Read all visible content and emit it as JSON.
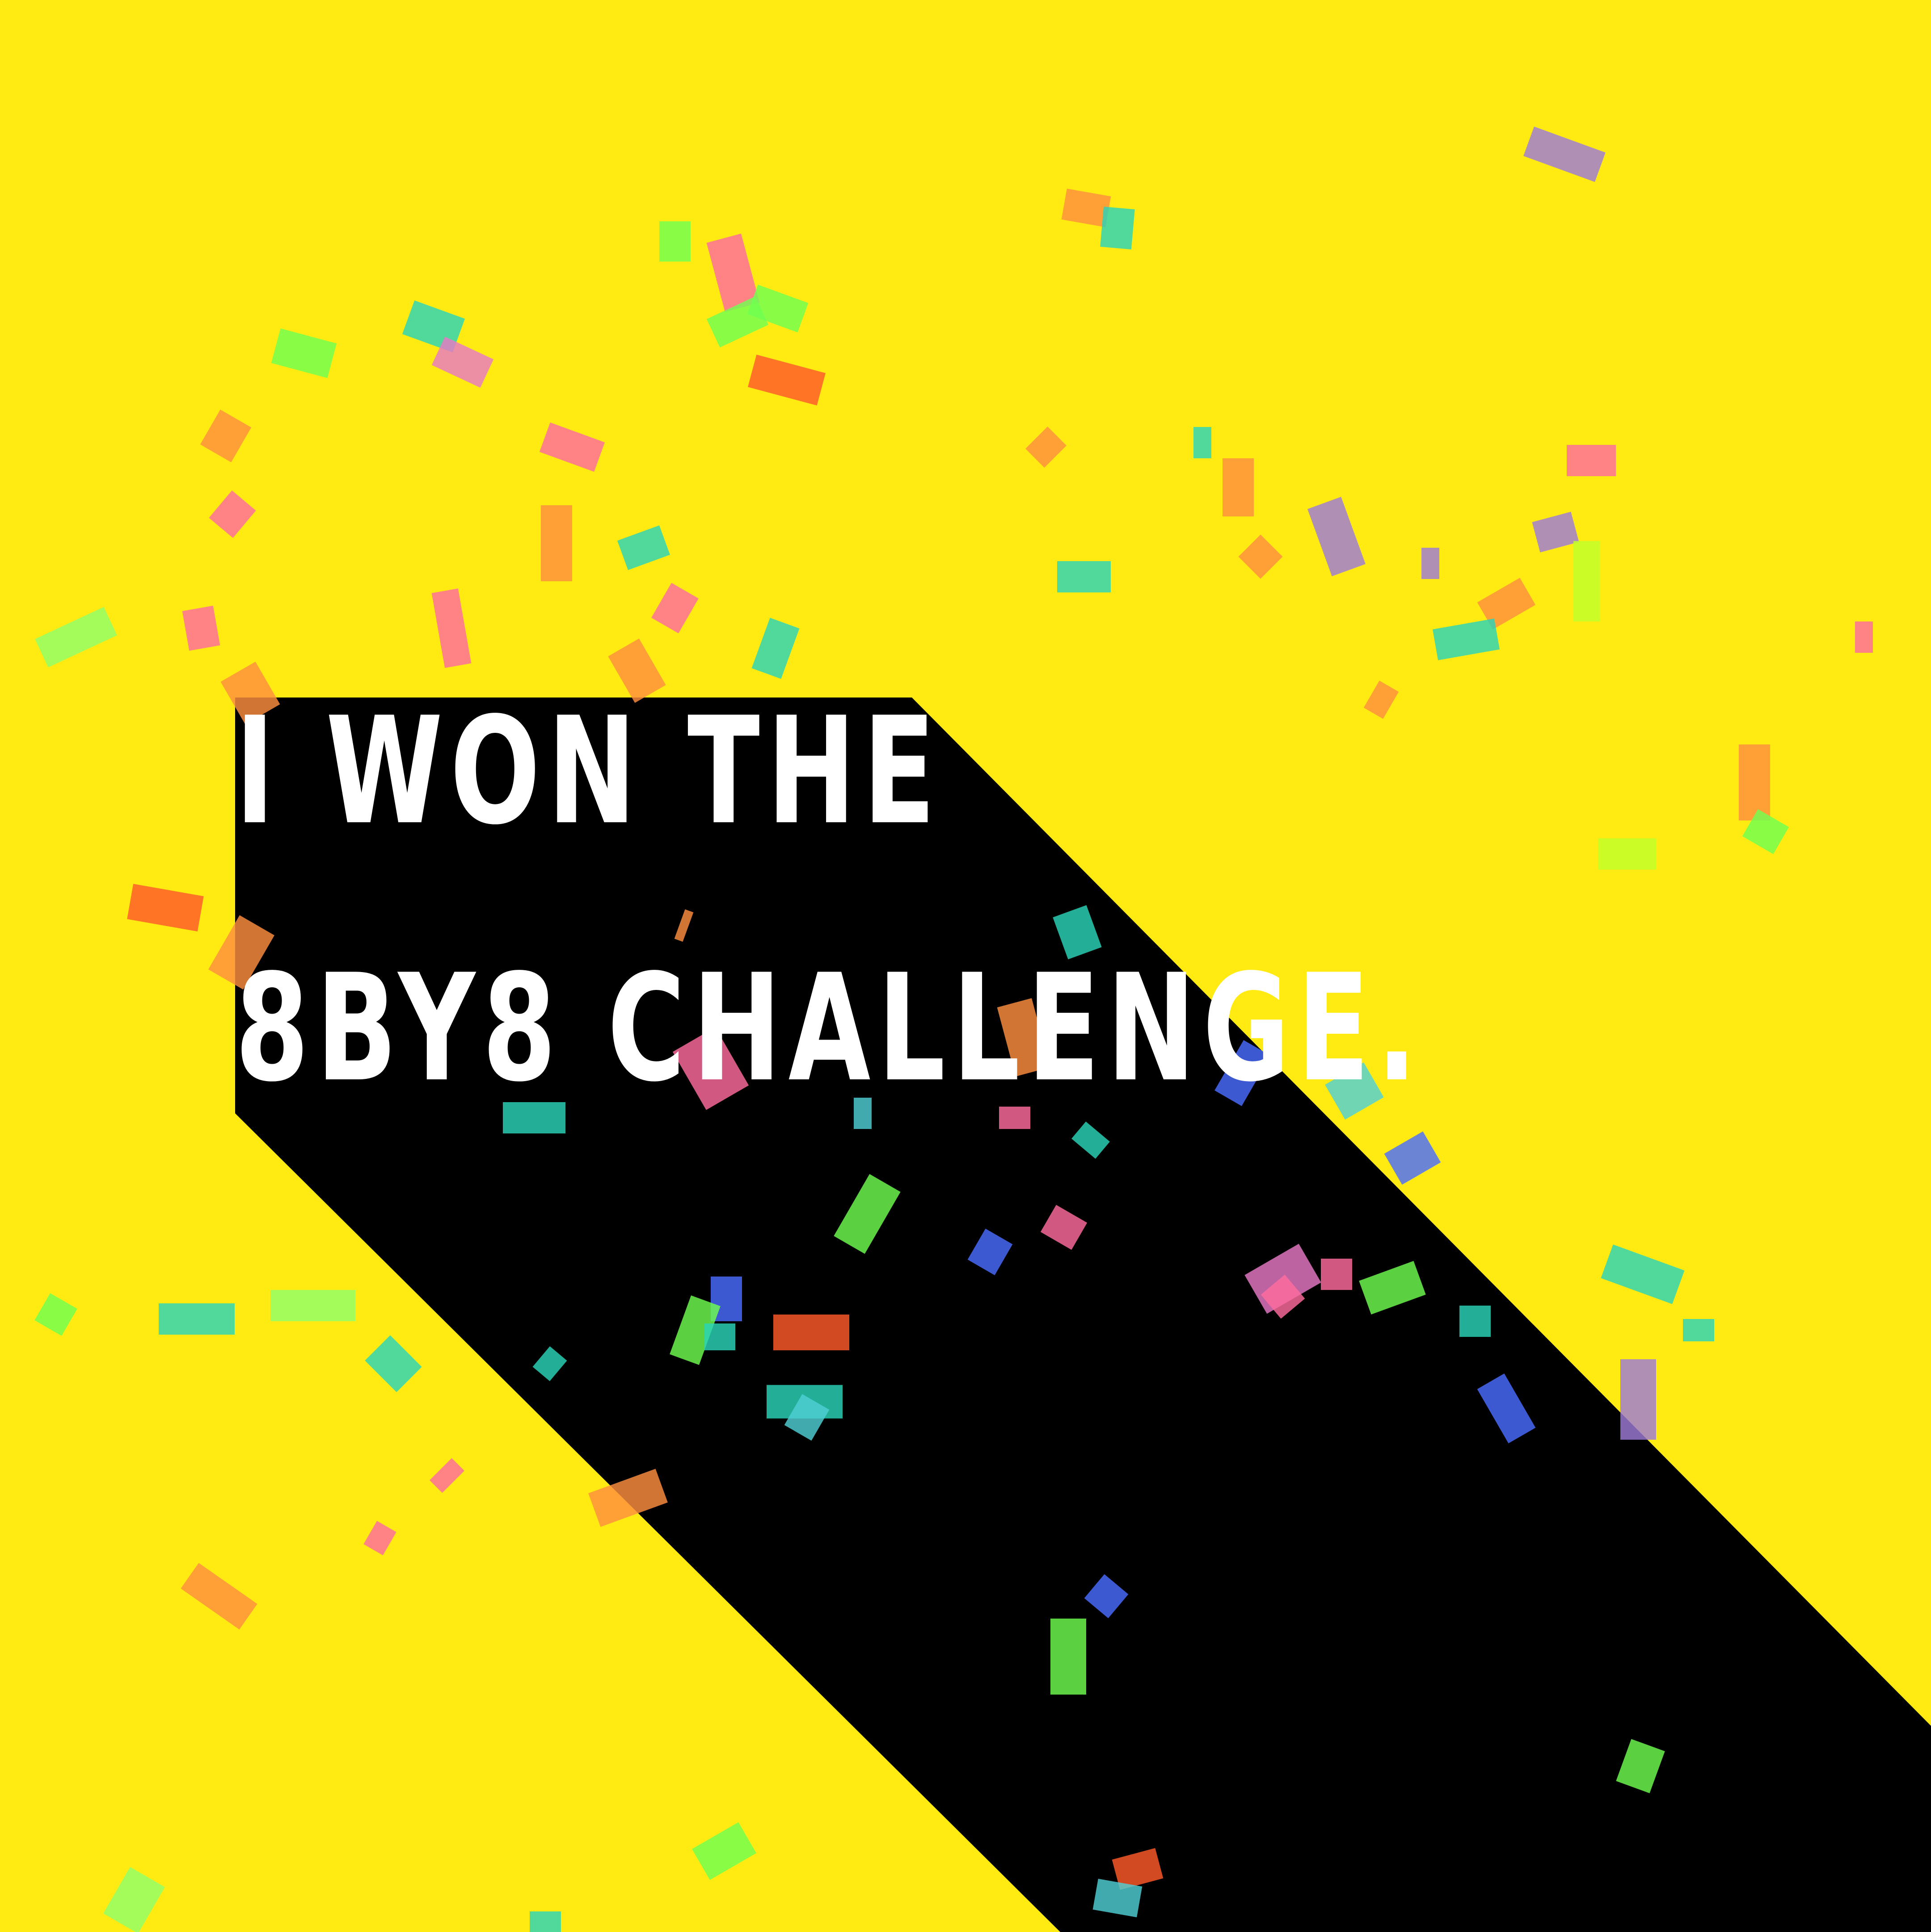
{
  "headline": {
    "line1": "I WON THE",
    "line2": "8BY8 CHALLENGE."
  },
  "colors": {
    "background": "#ffeb12",
    "shadow": "#000000",
    "text": "#ffffff",
    "confetti": [
      "#9d7bd8",
      "#ff8f3f",
      "#2ad4b8",
      "#6fff50",
      "#ff6b9e",
      "#e879c4",
      "#4fd0d6",
      "#ff5a2a",
      "#8fff6a",
      "#c0ff2a",
      "#4b6cff"
    ]
  }
}
